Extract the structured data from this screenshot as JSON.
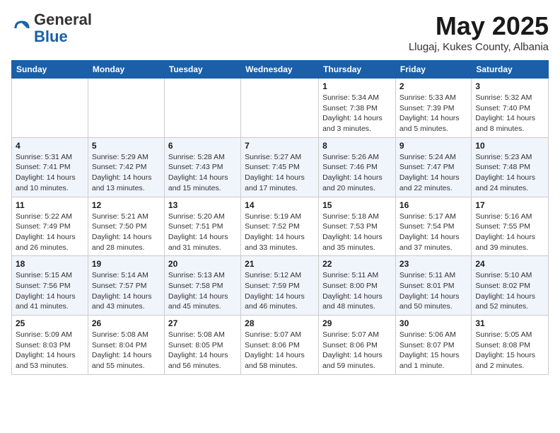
{
  "header": {
    "logo_general": "General",
    "logo_blue": "Blue",
    "month": "May 2025",
    "location": "Llugaj, Kukes County, Albania"
  },
  "weekdays": [
    "Sunday",
    "Monday",
    "Tuesday",
    "Wednesday",
    "Thursday",
    "Friday",
    "Saturday"
  ],
  "weeks": [
    [
      {
        "day": "",
        "detail": ""
      },
      {
        "day": "",
        "detail": ""
      },
      {
        "day": "",
        "detail": ""
      },
      {
        "day": "",
        "detail": ""
      },
      {
        "day": "1",
        "detail": "Sunrise: 5:34 AM\nSunset: 7:38 PM\nDaylight: 14 hours\nand 3 minutes."
      },
      {
        "day": "2",
        "detail": "Sunrise: 5:33 AM\nSunset: 7:39 PM\nDaylight: 14 hours\nand 5 minutes."
      },
      {
        "day": "3",
        "detail": "Sunrise: 5:32 AM\nSunset: 7:40 PM\nDaylight: 14 hours\nand 8 minutes."
      }
    ],
    [
      {
        "day": "4",
        "detail": "Sunrise: 5:31 AM\nSunset: 7:41 PM\nDaylight: 14 hours\nand 10 minutes."
      },
      {
        "day": "5",
        "detail": "Sunrise: 5:29 AM\nSunset: 7:42 PM\nDaylight: 14 hours\nand 13 minutes."
      },
      {
        "day": "6",
        "detail": "Sunrise: 5:28 AM\nSunset: 7:43 PM\nDaylight: 14 hours\nand 15 minutes."
      },
      {
        "day": "7",
        "detail": "Sunrise: 5:27 AM\nSunset: 7:45 PM\nDaylight: 14 hours\nand 17 minutes."
      },
      {
        "day": "8",
        "detail": "Sunrise: 5:26 AM\nSunset: 7:46 PM\nDaylight: 14 hours\nand 20 minutes."
      },
      {
        "day": "9",
        "detail": "Sunrise: 5:24 AM\nSunset: 7:47 PM\nDaylight: 14 hours\nand 22 minutes."
      },
      {
        "day": "10",
        "detail": "Sunrise: 5:23 AM\nSunset: 7:48 PM\nDaylight: 14 hours\nand 24 minutes."
      }
    ],
    [
      {
        "day": "11",
        "detail": "Sunrise: 5:22 AM\nSunset: 7:49 PM\nDaylight: 14 hours\nand 26 minutes."
      },
      {
        "day": "12",
        "detail": "Sunrise: 5:21 AM\nSunset: 7:50 PM\nDaylight: 14 hours\nand 28 minutes."
      },
      {
        "day": "13",
        "detail": "Sunrise: 5:20 AM\nSunset: 7:51 PM\nDaylight: 14 hours\nand 31 minutes."
      },
      {
        "day": "14",
        "detail": "Sunrise: 5:19 AM\nSunset: 7:52 PM\nDaylight: 14 hours\nand 33 minutes."
      },
      {
        "day": "15",
        "detail": "Sunrise: 5:18 AM\nSunset: 7:53 PM\nDaylight: 14 hours\nand 35 minutes."
      },
      {
        "day": "16",
        "detail": "Sunrise: 5:17 AM\nSunset: 7:54 PM\nDaylight: 14 hours\nand 37 minutes."
      },
      {
        "day": "17",
        "detail": "Sunrise: 5:16 AM\nSunset: 7:55 PM\nDaylight: 14 hours\nand 39 minutes."
      }
    ],
    [
      {
        "day": "18",
        "detail": "Sunrise: 5:15 AM\nSunset: 7:56 PM\nDaylight: 14 hours\nand 41 minutes."
      },
      {
        "day": "19",
        "detail": "Sunrise: 5:14 AM\nSunset: 7:57 PM\nDaylight: 14 hours\nand 43 minutes."
      },
      {
        "day": "20",
        "detail": "Sunrise: 5:13 AM\nSunset: 7:58 PM\nDaylight: 14 hours\nand 45 minutes."
      },
      {
        "day": "21",
        "detail": "Sunrise: 5:12 AM\nSunset: 7:59 PM\nDaylight: 14 hours\nand 46 minutes."
      },
      {
        "day": "22",
        "detail": "Sunrise: 5:11 AM\nSunset: 8:00 PM\nDaylight: 14 hours\nand 48 minutes."
      },
      {
        "day": "23",
        "detail": "Sunrise: 5:11 AM\nSunset: 8:01 PM\nDaylight: 14 hours\nand 50 minutes."
      },
      {
        "day": "24",
        "detail": "Sunrise: 5:10 AM\nSunset: 8:02 PM\nDaylight: 14 hours\nand 52 minutes."
      }
    ],
    [
      {
        "day": "25",
        "detail": "Sunrise: 5:09 AM\nSunset: 8:03 PM\nDaylight: 14 hours\nand 53 minutes."
      },
      {
        "day": "26",
        "detail": "Sunrise: 5:08 AM\nSunset: 8:04 PM\nDaylight: 14 hours\nand 55 minutes."
      },
      {
        "day": "27",
        "detail": "Sunrise: 5:08 AM\nSunset: 8:05 PM\nDaylight: 14 hours\nand 56 minutes."
      },
      {
        "day": "28",
        "detail": "Sunrise: 5:07 AM\nSunset: 8:06 PM\nDaylight: 14 hours\nand 58 minutes."
      },
      {
        "day": "29",
        "detail": "Sunrise: 5:07 AM\nSunset: 8:06 PM\nDaylight: 14 hours\nand 59 minutes."
      },
      {
        "day": "30",
        "detail": "Sunrise: 5:06 AM\nSunset: 8:07 PM\nDaylight: 15 hours\nand 1 minute."
      },
      {
        "day": "31",
        "detail": "Sunrise: 5:05 AM\nSunset: 8:08 PM\nDaylight: 15 hours\nand 2 minutes."
      }
    ]
  ]
}
